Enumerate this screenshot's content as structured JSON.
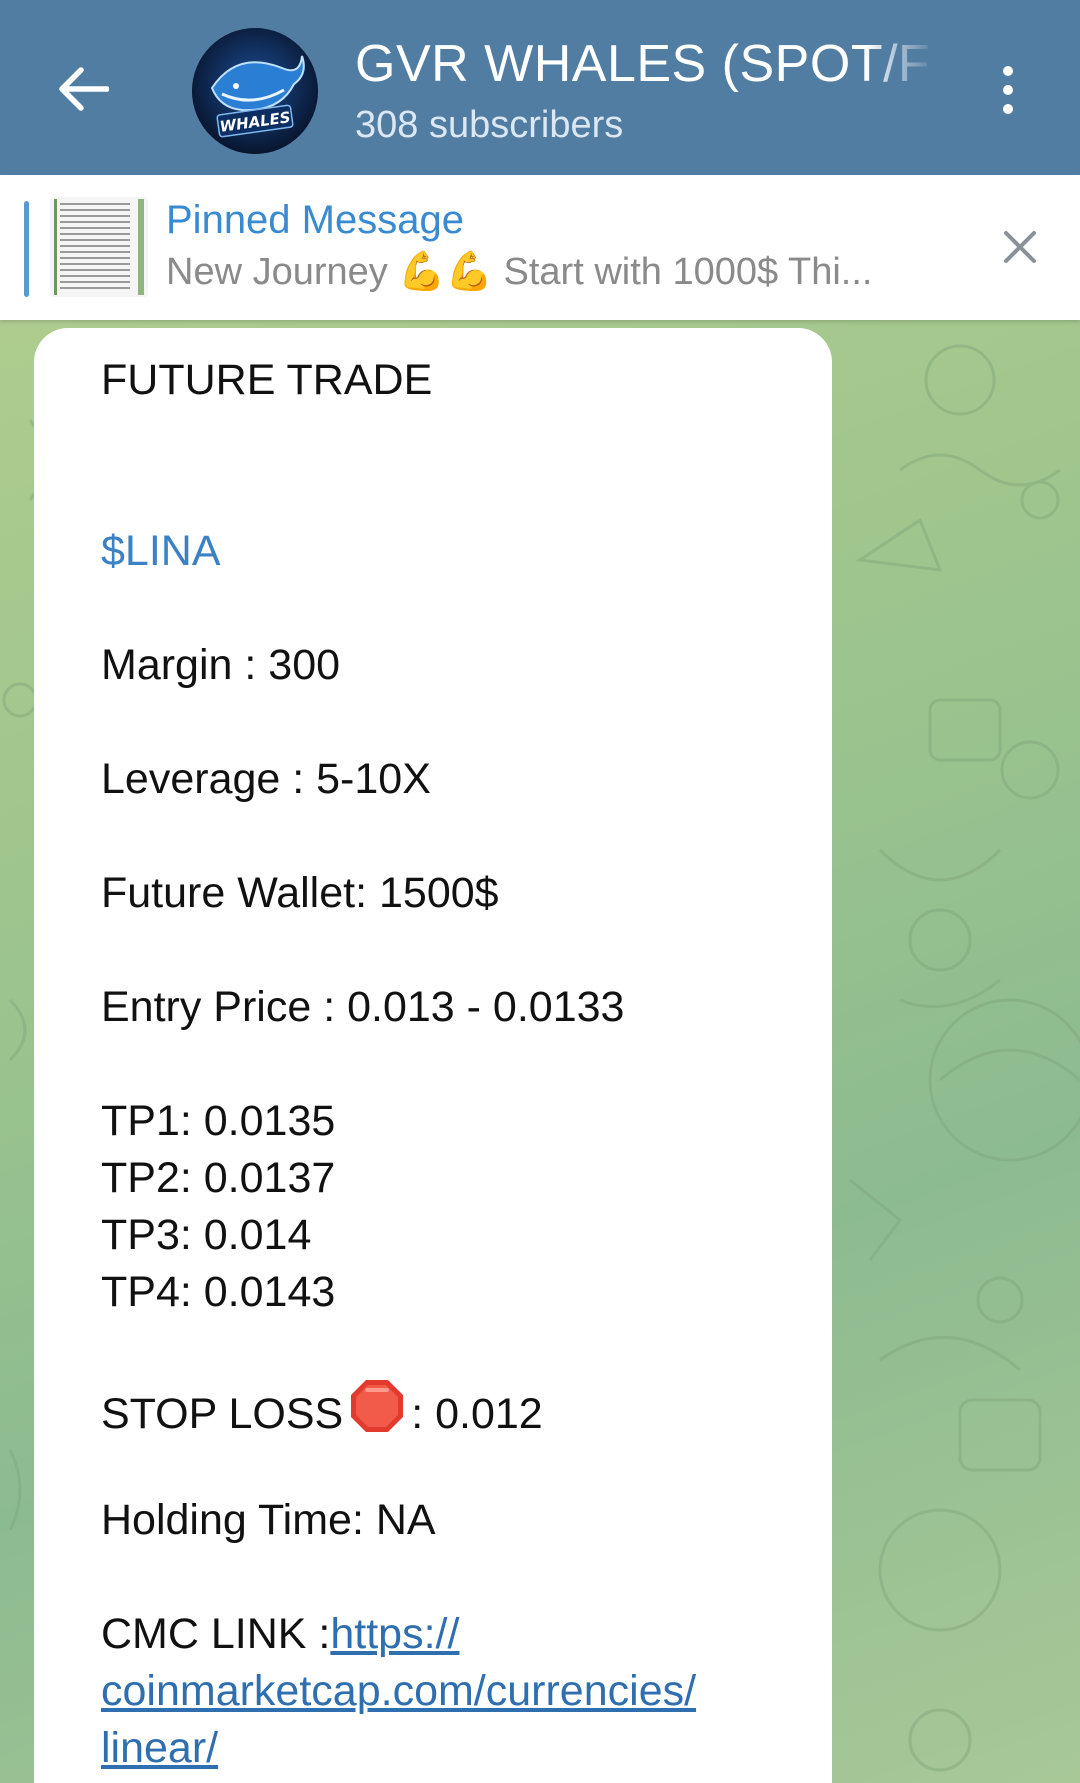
{
  "header": {
    "title": "GVR WHALES (SPOT/FU",
    "subtitle": "308 subscribers",
    "avatar_text": "WHALES",
    "colors": {
      "bar": "#527da3",
      "text": "#ffffff"
    }
  },
  "pinned": {
    "title": "Pinned Message",
    "text": "New Journey 💪💪 Start with 1000$  Thi..."
  },
  "message": {
    "lines": [
      "FUTURE TRADE",
      "$LINA",
      "Margin : 300",
      "Leverage : 5-10X",
      "Future Wallet: 1500$",
      "Entry Price : 0.013 -  0.0133",
      "TP1: 0.0135",
      "TP2: 0.0137",
      "TP3: 0.014",
      "TP4: 0.0143"
    ],
    "stop_loss_label": "STOP LOSS",
    "stop_loss_value": ": 0.012",
    "holding_time": "Holding Time: NA",
    "cmc_label": "CMC LINK :",
    "cmc_link_1": "https://",
    "cmc_link_2": "coinmarketcap.com/currencies/",
    "cmc_link_3": "linear/"
  },
  "icons": {
    "back": "arrow-left-icon",
    "menu": "kebab-menu-icon",
    "close": "close-icon",
    "stop": "stop-sign-icon"
  }
}
